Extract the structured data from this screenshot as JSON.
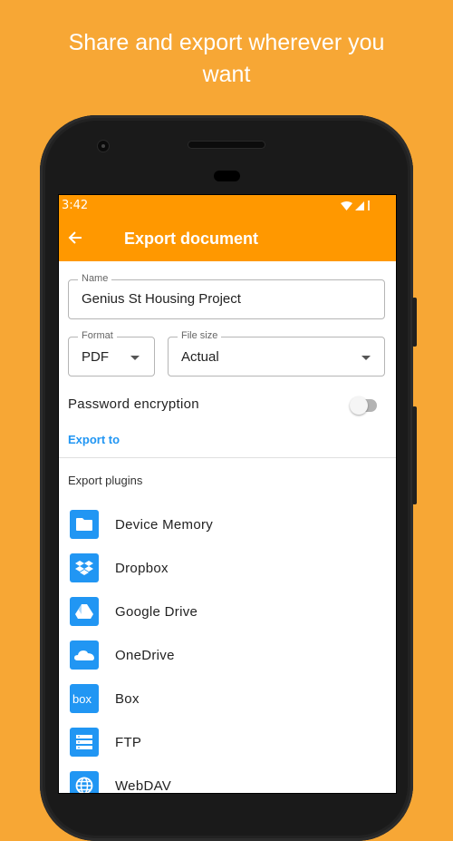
{
  "promo": {
    "headline_line1": "Share and export wherever you",
    "headline_line2": "want"
  },
  "statusbar": {
    "time": "3:42",
    "icons": [
      "wifi-icon",
      "signal-icon",
      "battery-icon"
    ]
  },
  "appbar": {
    "back_icon": "arrow-left-icon",
    "title": "Export document"
  },
  "form": {
    "name": {
      "label": "Name",
      "value": "Genius St Housing Project"
    },
    "format": {
      "label": "Format",
      "value": "PDF"
    },
    "file_size": {
      "label": "File size",
      "value": "Actual"
    },
    "password_encryption": {
      "label": "Password encryption",
      "enabled": false
    }
  },
  "export_to_label": "Export to",
  "plugins_section": {
    "title": "Export plugins",
    "items": [
      {
        "label": "Device Memory",
        "icon": "folder-icon"
      },
      {
        "label": "Dropbox",
        "icon": "dropbox-icon"
      },
      {
        "label": "Google Drive",
        "icon": "google-drive-icon"
      },
      {
        "label": "OneDrive",
        "icon": "onedrive-icon"
      },
      {
        "label": "Box",
        "icon": "box-icon"
      },
      {
        "label": "FTP",
        "icon": "server-icon"
      },
      {
        "label": "WebDAV",
        "icon": "globe-icon"
      }
    ]
  },
  "colors": {
    "background": "#F7A735",
    "appbar": "#FF9800",
    "accent": "#2196F3"
  }
}
